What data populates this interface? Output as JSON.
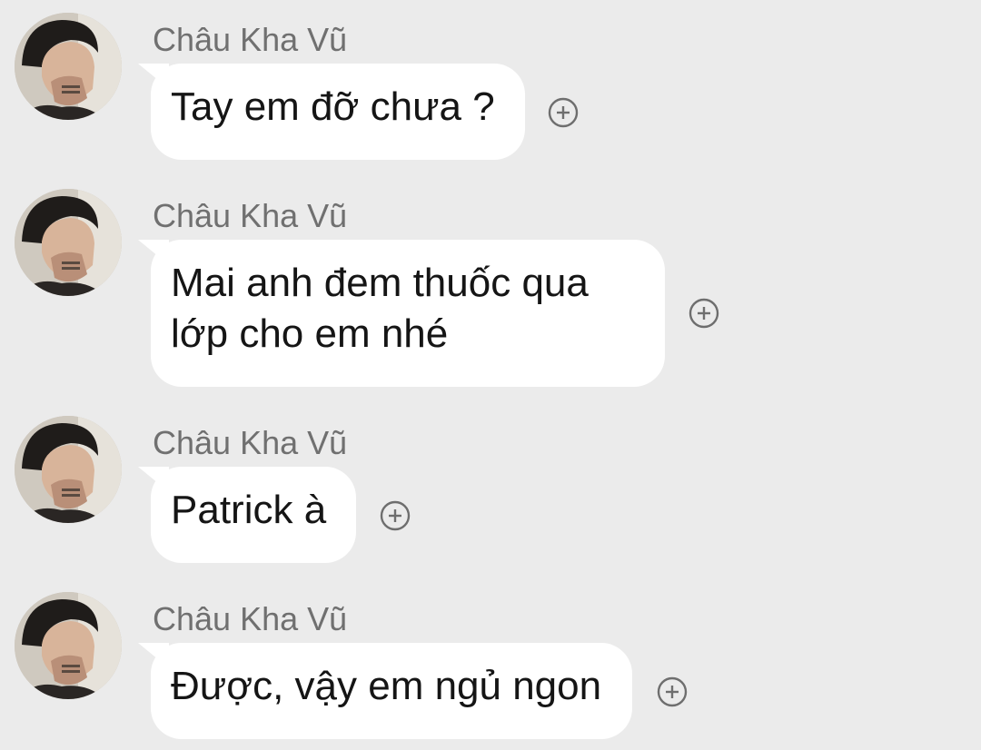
{
  "messages": [
    {
      "sender": "Châu Kha Vũ",
      "text": "Tay em đỡ chưa ?"
    },
    {
      "sender": "Châu Kha Vũ",
      "text": "Mai anh đem thuốc qua lớp cho em nhé"
    },
    {
      "sender": "Châu Kha Vũ",
      "text": "Patrick à"
    },
    {
      "sender": "Châu Kha Vũ",
      "text": "Được, vậy em ngủ ngon"
    }
  ],
  "icons": {
    "avatar": "avatar-photo",
    "reaction": "add-reaction-icon"
  },
  "colors": {
    "background": "#ebebeb",
    "bubble": "#ffffff",
    "sender_text": "#707070",
    "message_text": "#151515",
    "icon_stroke": "#6e6e6e"
  }
}
